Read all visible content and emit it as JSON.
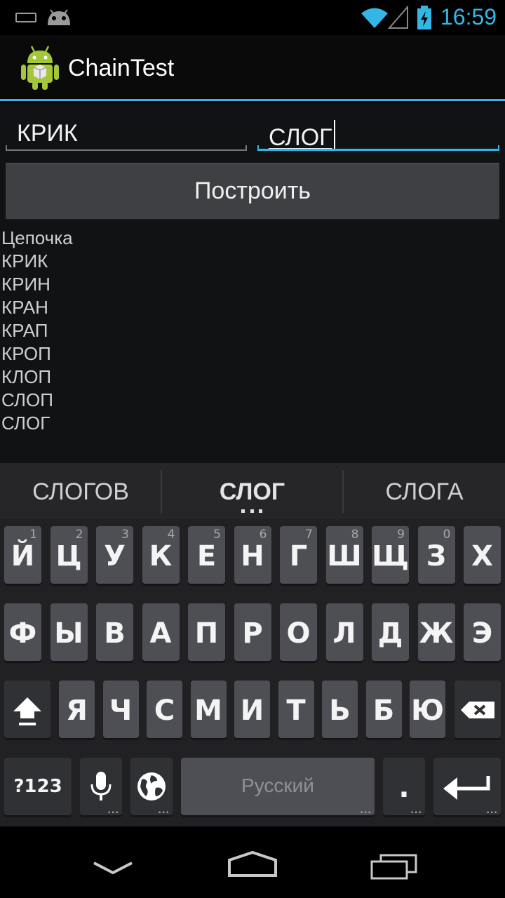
{
  "status_bar": {
    "time": "16:59",
    "icons": [
      "keyboard-icon",
      "android-notify-icon",
      "wifi-icon",
      "signal-icon",
      "battery-charging-icon"
    ]
  },
  "action_bar": {
    "title": "ChainTest",
    "icon": "android-app-icon"
  },
  "form": {
    "from_word": "КРИК",
    "to_word": "СЛОГ",
    "build_button": "Построить"
  },
  "chain": {
    "heading": "Цепочка",
    "words": [
      "КРИК",
      "КРИН",
      "КРАН",
      "КРАП",
      "КРОП",
      "КЛОП",
      "СЛОП",
      "СЛОГ"
    ]
  },
  "suggestions": [
    "СЛОГОВ",
    "СЛОГ",
    "СЛОГА"
  ],
  "keyboard": {
    "row1": [
      {
        "key": "Й",
        "hint": "1"
      },
      {
        "key": "Ц",
        "hint": "2"
      },
      {
        "key": "У",
        "hint": "3"
      },
      {
        "key": "К",
        "hint": "4"
      },
      {
        "key": "Е",
        "hint": "5"
      },
      {
        "key": "Н",
        "hint": "6"
      },
      {
        "key": "Г",
        "hint": "7"
      },
      {
        "key": "Ш",
        "hint": "8"
      },
      {
        "key": "Щ",
        "hint": "9"
      },
      {
        "key": "З",
        "hint": "0"
      },
      {
        "key": "Х",
        "hint": ""
      }
    ],
    "row2": [
      "Ф",
      "Ы",
      "В",
      "А",
      "П",
      "Р",
      "О",
      "Л",
      "Д",
      "Ж",
      "Э"
    ],
    "row3": [
      "Я",
      "Ч",
      "С",
      "М",
      "И",
      "Т",
      "Ь",
      "Б",
      "Ю"
    ],
    "symbols_label": "?123",
    "space_label": "Русский",
    "period_label": ".",
    "colors": {
      "accent": "#33b5e5",
      "key": "#4d4f54",
      "key_dark": "#2f3134"
    }
  },
  "nav_bar": {
    "icons": [
      "back-icon",
      "home-icon",
      "recents-icon"
    ]
  }
}
